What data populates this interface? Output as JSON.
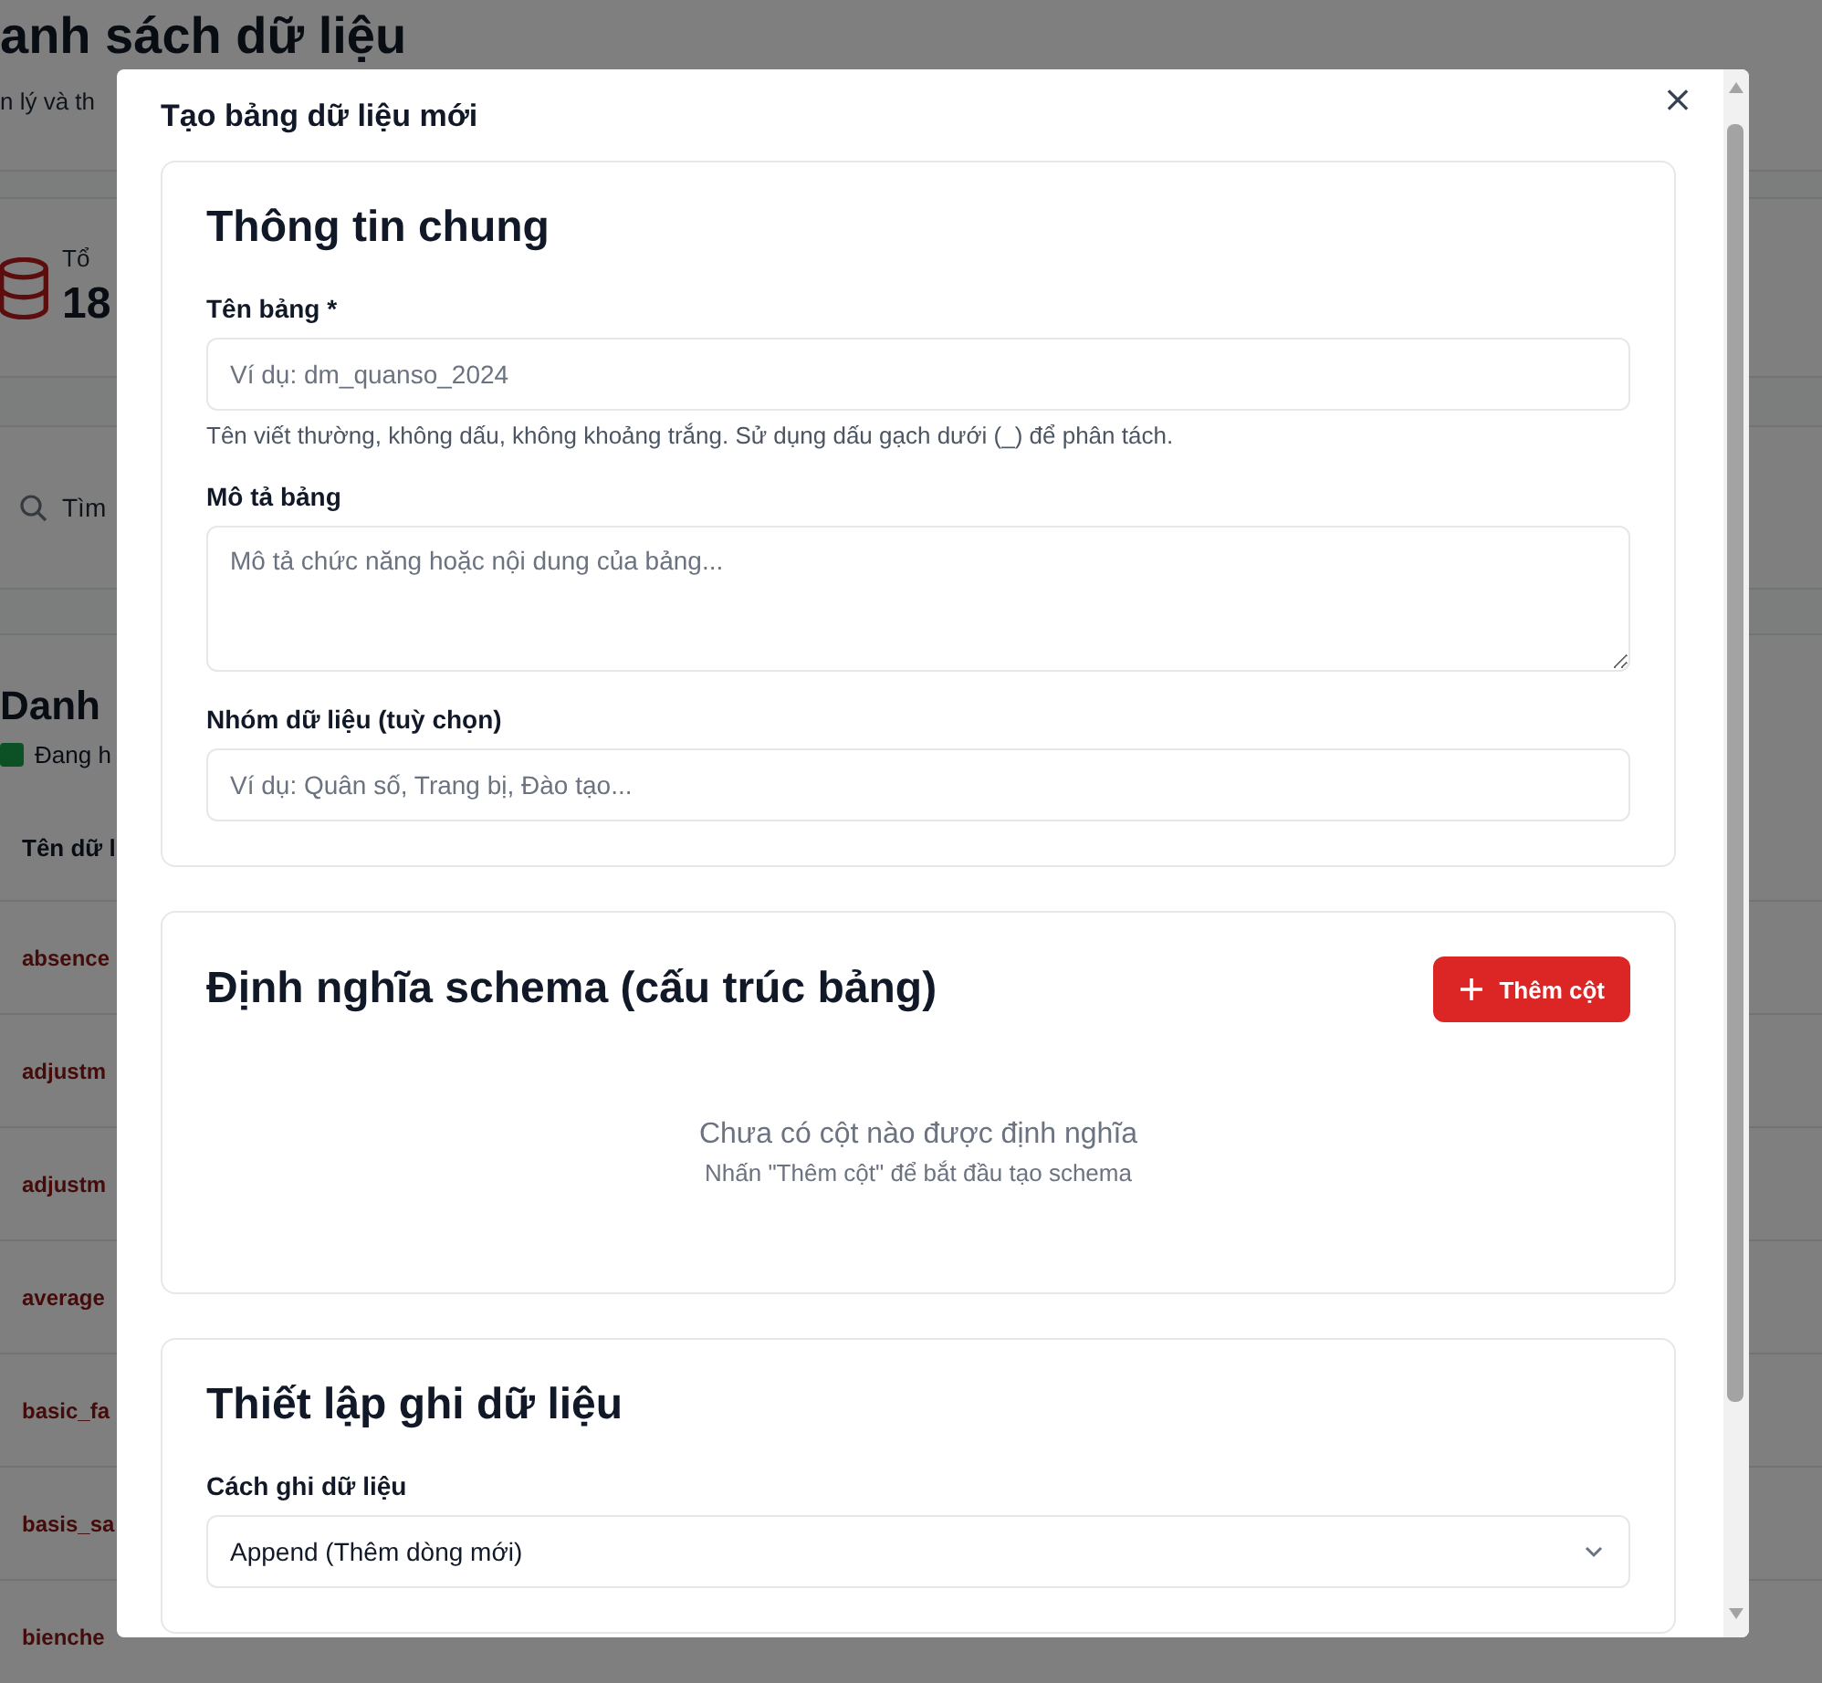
{
  "background": {
    "heading": "anh sách dữ liệu",
    "subtitle": "n lý và th",
    "stat": {
      "label": "Tổ",
      "value": "18"
    },
    "search": {
      "placeholder": "Tìm"
    },
    "list_title": "Danh",
    "filter": {
      "label": "Đang h",
      "checked": true
    },
    "table": {
      "columns": [
        "Tên dữ l"
      ],
      "rows": [
        {
          "name": "absence"
        },
        {
          "name": "adjustm"
        },
        {
          "name": "adjustm"
        },
        {
          "name": "average"
        },
        {
          "name": "basic_fa"
        },
        {
          "name": "basis_sa"
        },
        {
          "name": "bienche"
        }
      ]
    }
  },
  "modal": {
    "title": "Tạo bảng dữ liệu mới",
    "close": "×",
    "sections": [
      {
        "kind": "form",
        "title": "Thông tin chung",
        "fields": [
          {
            "kind": "input",
            "label": "Tên bảng *",
            "placeholder": "Ví dụ: dm_quanso_2024",
            "hint": "Tên viết thường, không dấu, không khoảng trắng. Sử dụng dấu gạch dưới (_) để phân tách."
          },
          {
            "kind": "textarea",
            "label": "Mô tả bảng",
            "placeholder": "Mô tả chức năng hoặc nội dung của bảng..."
          },
          {
            "kind": "input",
            "label": "Nhóm dữ liệu (tuỳ chọn)",
            "placeholder": "Ví dụ: Quân số, Trang bị, Đào tạo..."
          }
        ]
      },
      {
        "kind": "schema",
        "title": "Định nghĩa schema (cấu trúc bảng)",
        "button": "Thêm cột",
        "empty_title": "Chưa có cột nào được định nghĩa",
        "empty_hint": "Nhấn \"Thêm cột\" để bắt đầu tạo schema"
      },
      {
        "kind": "form",
        "title": "Thiết lập ghi dữ liệu",
        "fields": [
          {
            "kind": "select",
            "label": "Cách ghi dữ liệu",
            "value": "Append (Thêm dòng mới)"
          }
        ]
      }
    ]
  }
}
